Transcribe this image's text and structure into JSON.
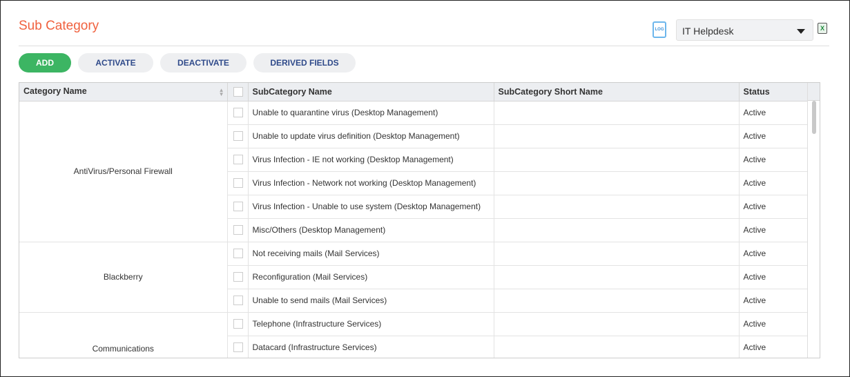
{
  "title": "Sub Category",
  "log_icon": "LOG",
  "selector": {
    "value": "IT Helpdesk"
  },
  "excel_icon": "X",
  "buttons": {
    "add": "ADD",
    "activate": "ACTIVATE",
    "deactivate": "DEACTIVATE",
    "derived": "DERIVED FIELDS"
  },
  "colors": {
    "accent": "#f0613e",
    "add": "#3cb563"
  },
  "columns": [
    "Category Name",
    "SubCategory Name",
    "SubCategory Short Name",
    "Status"
  ],
  "groups": [
    {
      "category": "AntiVirus/Personal Firewall",
      "rows": [
        {
          "name": "Unable to quarantine virus (Desktop Management)",
          "short": "",
          "status": "Active"
        },
        {
          "name": "Unable to update virus definition (Desktop Management)",
          "short": "",
          "status": "Active"
        },
        {
          "name": "Virus Infection - IE not working (Desktop Management)",
          "short": "",
          "status": "Active"
        },
        {
          "name": "Virus Infection - Network not working (Desktop Management)",
          "short": "",
          "status": "Active"
        },
        {
          "name": "Virus Infection - Unable to use system (Desktop Management)",
          "short": "",
          "status": "Active"
        },
        {
          "name": "Misc/Others (Desktop Management)",
          "short": "",
          "status": "Active"
        }
      ]
    },
    {
      "category": "Blackberry",
      "rows": [
        {
          "name": "Not receiving mails (Mail Services)",
          "short": "",
          "status": "Active"
        },
        {
          "name": "Reconfiguration (Mail Services)",
          "short": "",
          "status": "Active"
        },
        {
          "name": "Unable to send mails (Mail Services)",
          "short": "",
          "status": "Active"
        }
      ]
    },
    {
      "category": "Communications",
      "rows": [
        {
          "name": "Telephone (Infrastructure Services)",
          "short": "",
          "status": "Active"
        },
        {
          "name": "Datacard (Infrastructure Services)",
          "short": "",
          "status": "Active"
        }
      ]
    }
  ]
}
